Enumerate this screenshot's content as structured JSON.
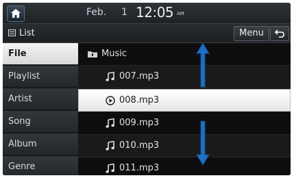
{
  "status": {
    "date": "Feb.",
    "day": "1",
    "time": "12:05",
    "ampm": "AM"
  },
  "header": {
    "title": "List",
    "menu_label": "Menu"
  },
  "sidebar": {
    "tabs": [
      {
        "label": "File",
        "active": true
      },
      {
        "label": "Playlist",
        "active": false
      },
      {
        "label": "Artist",
        "active": false
      },
      {
        "label": "Song",
        "active": false
      },
      {
        "label": "Album",
        "active": false
      },
      {
        "label": "Genre",
        "active": false
      }
    ]
  },
  "list": {
    "items": [
      {
        "label": "Music",
        "icon": "folder-icon"
      },
      {
        "label": "007.mp3",
        "icon": "music-note-icon"
      },
      {
        "label": "008.mp3",
        "icon": "play-circle-icon",
        "selected": true
      },
      {
        "label": "009.mp3",
        "icon": "music-note-icon"
      },
      {
        "label": "010.mp3",
        "icon": "music-note-icon"
      },
      {
        "label": "011.mp3",
        "icon": "music-note-icon"
      }
    ]
  },
  "colors": {
    "accent_arrow": "#1f6fc4",
    "selected_row": "#f2f2f2"
  }
}
